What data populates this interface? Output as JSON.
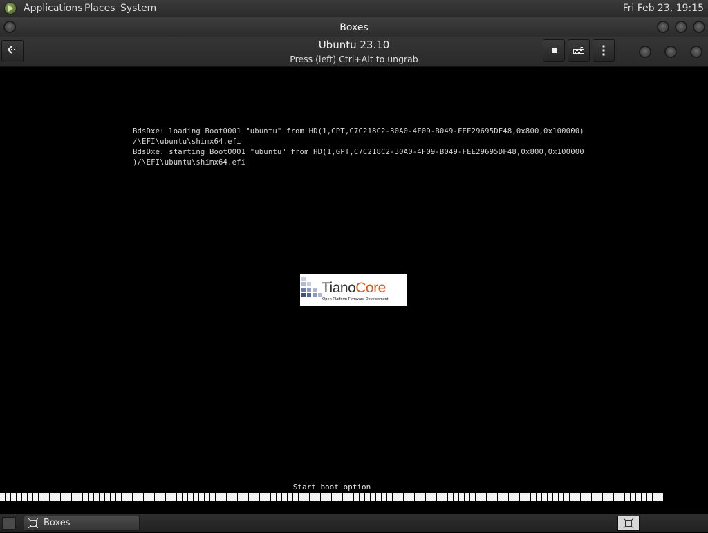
{
  "top_panel": {
    "menus": [
      "Applications",
      "Places",
      "System"
    ],
    "clock": "Fri Feb 23, 19:15"
  },
  "window": {
    "title": "Boxes"
  },
  "headerbar": {
    "vm_title": "Ubuntu 23.10",
    "vm_subtitle": "Press (left) Ctrl+Alt to ungrab"
  },
  "console": {
    "lines": [
      "BdsDxe: loading Boot0001 \"ubuntu\" from HD(1,GPT,C7C218C2-30A0-4F09-B049-FEE29695DF48,0x800,0x100000)",
      "/\\EFI\\ubuntu\\shimx64.efi",
      "BdsDxe: starting Boot0001 \"ubuntu\" from HD(1,GPT,C7C218C2-30A0-4F09-B049-FEE29695DF48,0x800,0x100000",
      ")/\\EFI\\ubuntu\\shimx64.efi"
    ],
    "logo": {
      "name_part1": "Tiano",
      "name_part2": "Core",
      "tagline": "Open Platform Firmware Development",
      "accent_color": "#e05a1b"
    },
    "boot_status": "Start boot option",
    "boot_progress_fraction": 1.0
  },
  "taskbar": {
    "items": [
      {
        "label": "Boxes"
      }
    ]
  }
}
